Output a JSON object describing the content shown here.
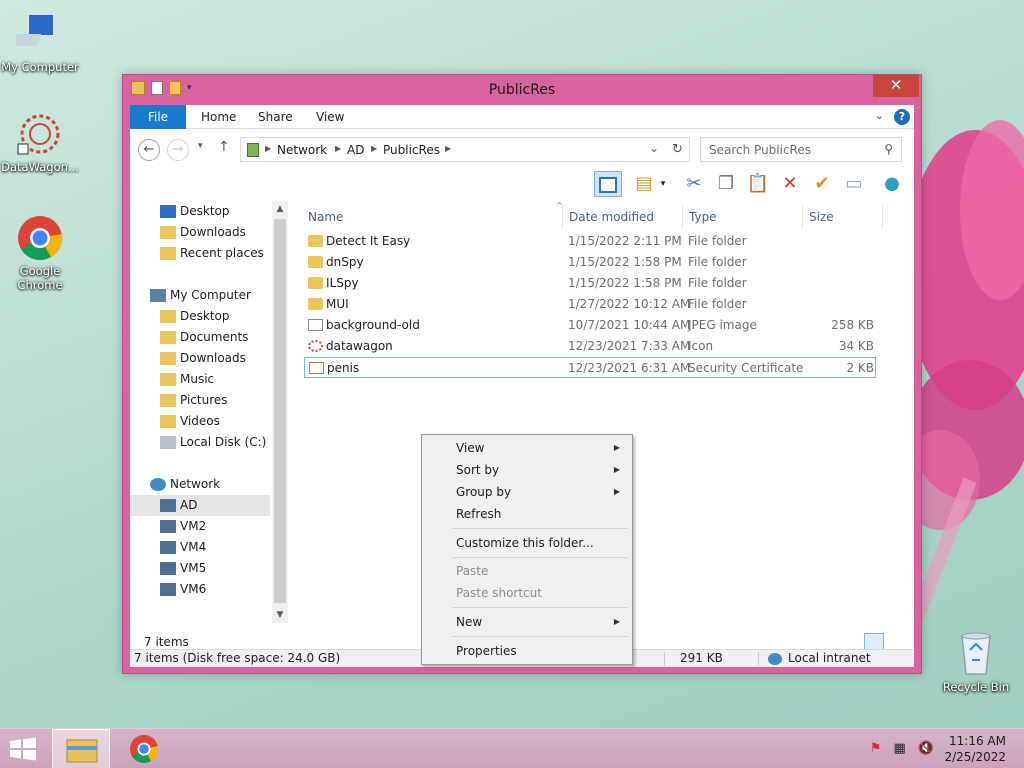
{
  "desktop": {
    "icons": [
      {
        "label": "My Computer",
        "icon": "computer-icon"
      },
      {
        "label": "DataWagon...",
        "icon": "datawagon-icon"
      },
      {
        "label": "Google Chrome",
        "icon": "chrome-icon"
      },
      {
        "label": "Recycle Bin",
        "icon": "recycle-bin-icon"
      }
    ]
  },
  "window": {
    "title": "PublicRes",
    "close_label": "✕"
  },
  "ribbon": {
    "tabs": [
      "File",
      "Home",
      "Share",
      "View"
    ],
    "help_label": "?"
  },
  "address": {
    "crumbs": [
      "Network",
      "AD",
      "PublicRes"
    ],
    "search_placeholder": "Search PublicRes"
  },
  "nav": {
    "favorites": [
      "Desktop",
      "Downloads",
      "Recent places"
    ],
    "computer_label": "My Computer",
    "computer_children": [
      "Desktop",
      "Documents",
      "Downloads",
      "Music",
      "Pictures",
      "Videos",
      "Local Disk (C:)"
    ],
    "network_label": "Network",
    "network_children": [
      "AD",
      "VM2",
      "VM4",
      "VM5",
      "VM6"
    ],
    "selected": "AD"
  },
  "columns": [
    "Name",
    "Date modified",
    "Type",
    "Size"
  ],
  "files": [
    {
      "name": "Detect It Easy",
      "date": "1/15/2022 2:11 PM",
      "type": "File folder",
      "size": "",
      "icon": "folder-icon"
    },
    {
      "name": "dnSpy",
      "date": "1/15/2022 1:58 PM",
      "type": "File folder",
      "size": "",
      "icon": "folder-icon"
    },
    {
      "name": "ILSpy",
      "date": "1/15/2022 1:58 PM",
      "type": "File folder",
      "size": "",
      "icon": "folder-icon"
    },
    {
      "name": "MUI",
      "date": "1/27/2022 10:12 AM",
      "type": "File folder",
      "size": "",
      "icon": "folder-icon"
    },
    {
      "name": "background-old",
      "date": "10/7/2021 10:44 AM",
      "type": "JPEG image",
      "size": "258 KB",
      "icon": "image-file-icon"
    },
    {
      "name": "datawagon",
      "date": "12/23/2021 7:33 AM",
      "type": "Icon",
      "size": "34 KB",
      "icon": "ico-file-icon"
    },
    {
      "name": "penis",
      "date": "12/23/2021 6:31 AM",
      "type": "Security Certificate",
      "size": "2 KB",
      "icon": "certificate-icon"
    }
  ],
  "status": {
    "items_count": "7 items",
    "disk_free": "7 items (Disk free space: 24.0 GB)",
    "size_total": "291 KB",
    "zone": "Local intranet"
  },
  "context_menu": {
    "items": [
      {
        "label": "View",
        "submenu": true,
        "disabled": false
      },
      {
        "label": "Sort by",
        "submenu": true,
        "disabled": false
      },
      {
        "label": "Group by",
        "submenu": true,
        "disabled": false
      },
      {
        "label": "Refresh",
        "submenu": false,
        "disabled": false
      },
      {
        "label": "Customize this folder...",
        "submenu": false,
        "disabled": false
      },
      {
        "label": "Paste",
        "submenu": false,
        "disabled": true
      },
      {
        "label": "Paste shortcut",
        "submenu": false,
        "disabled": true
      },
      {
        "label": "New",
        "submenu": true,
        "disabled": false
      },
      {
        "label": "Properties",
        "submenu": false,
        "disabled": false
      }
    ]
  },
  "taskbar": {
    "time": "11:16 AM",
    "date": "2/25/2022"
  }
}
